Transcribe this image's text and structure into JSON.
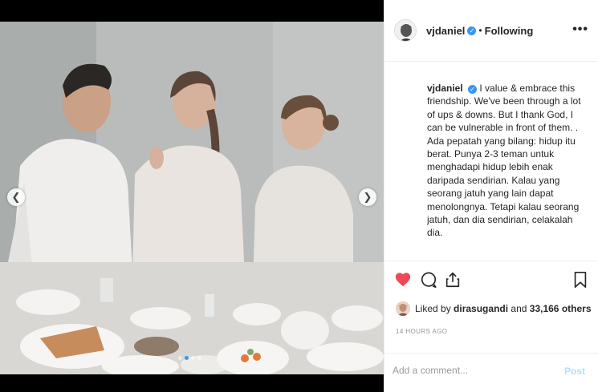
{
  "header": {
    "username": "vjdaniel",
    "separator": "•",
    "follow_status": "Following",
    "more_label": "•••"
  },
  "caption": {
    "username": "vjdaniel",
    "text": "I value & embrace this friendship. We've been through a lot of ups & downs. But I thank God, I can be vulnerable in front of them. . Ada pepatah yang bilang: hidup itu berat. Punya 2-3 teman untuk menghadapi hidup lebih enak daripada sendirian. Kalau yang seorang jatuh yang lain dapat menolongnya. Tetapi kalau seorang jatuh, dan dia sendirian, celakalah dia."
  },
  "likes": {
    "prefix": "Liked by",
    "liker": "dirasugandi",
    "connector": "and",
    "others": "33,166 others"
  },
  "timestamp": "14 HOURS AGO",
  "comment": {
    "placeholder": "Add a comment...",
    "post_label": "Post"
  },
  "carousel": {
    "total_slides": 4,
    "active_slide": 2
  },
  "colors": {
    "like_red": "#ed4956",
    "verified_blue": "#3897f0",
    "post_disabled": "#b2dffc"
  },
  "icons": [
    "chevron-left-icon",
    "chevron-right-icon",
    "verified-badge-icon",
    "more-icon",
    "heart-icon",
    "comment-icon",
    "share-icon",
    "bookmark-icon"
  ]
}
